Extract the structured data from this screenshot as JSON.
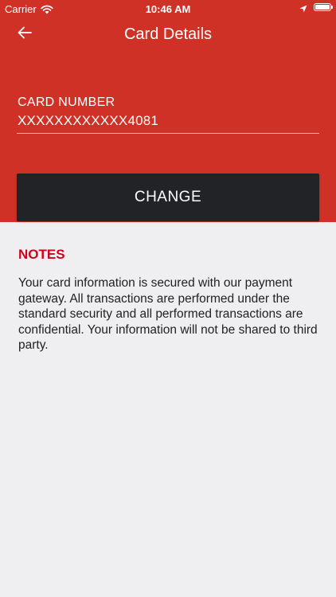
{
  "status_bar": {
    "carrier": "Carrier",
    "time": "10:46 AM"
  },
  "nav": {
    "title": "Card Details",
    "back_icon": "arrow-left-icon"
  },
  "card": {
    "label": "CARD NUMBER",
    "number": "XXXXXXXXXXXX4081"
  },
  "actions": {
    "change_label": "CHANGE"
  },
  "notes": {
    "title": "NOTES",
    "body": "Your card information is secured with our payment gateway. All transactions are performed under the standard security and all performed transactions are confidential. Your information will not be shared to third party."
  },
  "colors": {
    "header": "#cf3127",
    "button": "#222326",
    "notes_title": "#d0021b",
    "background": "#efeff2"
  }
}
